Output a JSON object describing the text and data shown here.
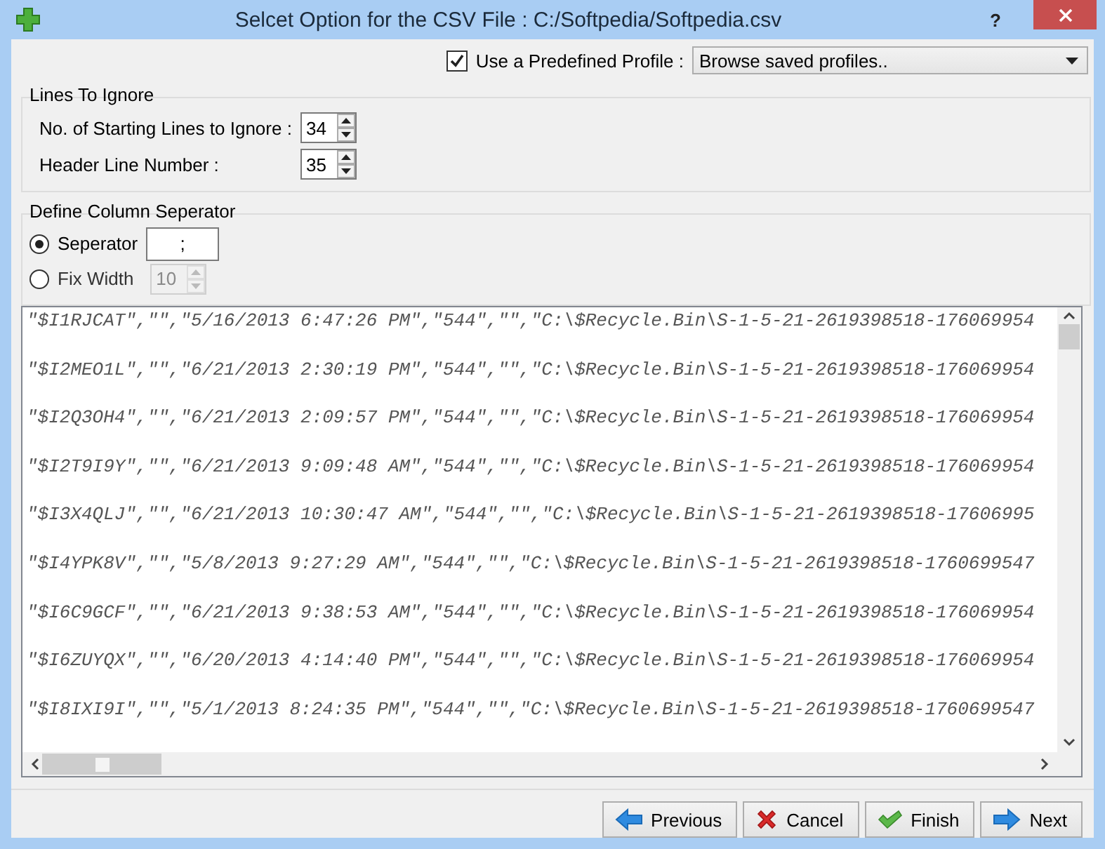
{
  "window": {
    "title": "Selcet Option for the CSV File : C:/Softpedia/Softpedia.csv",
    "help": "?"
  },
  "profile": {
    "checked": true,
    "label": "Use a Predefined Profile :",
    "dropdown": "Browse saved profiles.."
  },
  "lines_to_ignore": {
    "title": "Lines To Ignore",
    "fields": [
      {
        "label": "No. of Starting Lines to Ignore :",
        "value": "34",
        "disabled": false
      },
      {
        "label": "Header Line Number :",
        "value": "35",
        "disabled": false
      }
    ]
  },
  "column_separator": {
    "title": "Define Column Seperator",
    "options": [
      {
        "label": "Seperator",
        "selected": true,
        "kind": "text",
        "value": ";",
        "disabled": false
      },
      {
        "label": "Fix Width",
        "selected": false,
        "kind": "spin",
        "value": "10",
        "disabled": true
      }
    ]
  },
  "preview": {
    "lines": [
      "\"$I1RJCAT\",\"\",\"5/16/2013 6:47:26 PM\",\"544\",\"\",\"C:\\$Recycle.Bin\\S-1-5-21-2619398518-176069954",
      "\"$I2MEO1L\",\"\",\"6/21/2013 2:30:19 PM\",\"544\",\"\",\"C:\\$Recycle.Bin\\S-1-5-21-2619398518-176069954",
      "\"$I2Q3OH4\",\"\",\"6/21/2013 2:09:57 PM\",\"544\",\"\",\"C:\\$Recycle.Bin\\S-1-5-21-2619398518-176069954",
      "\"$I2T9I9Y\",\"\",\"6/21/2013 9:09:48 AM\",\"544\",\"\",\"C:\\$Recycle.Bin\\S-1-5-21-2619398518-176069954",
      "\"$I3X4QLJ\",\"\",\"6/21/2013 10:30:47 AM\",\"544\",\"\",\"C:\\$Recycle.Bin\\S-1-5-21-2619398518-17606995",
      "\"$I4YPK8V\",\"\",\"5/8/2013 9:27:29 AM\",\"544\",\"\",\"C:\\$Recycle.Bin\\S-1-5-21-2619398518-1760699547",
      "\"$I6C9GCF\",\"\",\"6/21/2013 9:38:53 AM\",\"544\",\"\",\"C:\\$Recycle.Bin\\S-1-5-21-2619398518-176069954",
      "\"$I6ZUYQX\",\"\",\"6/20/2013 4:14:40 PM\",\"544\",\"\",\"C:\\$Recycle.Bin\\S-1-5-21-2619398518-176069954",
      "\"$I8IXI9I\",\"\",\"5/1/2013 8:24:35 PM\",\"544\",\"\",\"C:\\$Recycle.Bin\\S-1-5-21-2619398518-1760699547"
    ]
  },
  "buttons": [
    {
      "label": "Previous",
      "kind": "previous"
    },
    {
      "label": "Cancel",
      "kind": "cancel"
    },
    {
      "label": "Finish",
      "kind": "finish"
    },
    {
      "label": "Next",
      "kind": "next"
    }
  ]
}
